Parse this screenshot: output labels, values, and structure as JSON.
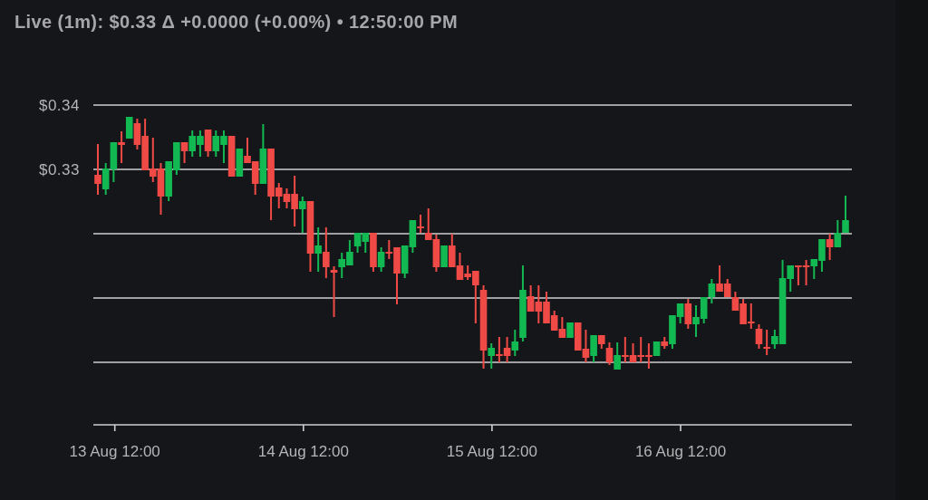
{
  "header": {
    "text": "Live (1m): $0.33 Δ +0.0000 (+0.00%) • 12:50:00 PM"
  },
  "chart": {
    "y_tick_labels": [
      "$0.34",
      "$0.33"
    ],
    "x_tick_labels": [
      "13 Aug 12:00",
      "14 Aug 12:00",
      "15 Aug 12:00",
      "16 Aug 12:00"
    ]
  }
}
